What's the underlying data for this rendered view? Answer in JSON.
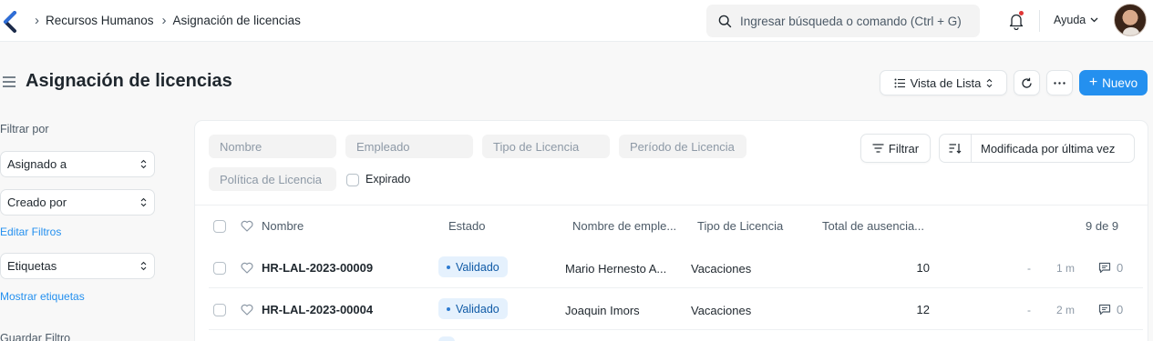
{
  "navbar": {
    "breadcrumbs": [
      "Recursos Humanos",
      "Asignación de licencias"
    ],
    "search_placeholder": "Ingresar búsqueda o comando (Ctrl + G)",
    "help_label": "Ayuda"
  },
  "page": {
    "title": "Asignación de licencias",
    "view_label": "Vista de Lista",
    "new_label": "Nuevo"
  },
  "sidebar": {
    "filter_by_label": "Filtrar por",
    "assigned_to": "Asignado a",
    "created_by": "Creado por",
    "edit_filters": "Editar Filtros",
    "tags": "Etiquetas",
    "show_tags": "Mostrar etiquetas",
    "save_filter": "Guardar Filtro"
  },
  "filters": {
    "name_placeholder": "Nombre",
    "employee_placeholder": "Empleado",
    "leave_type_placeholder": "Tipo de Licencia",
    "period_placeholder": "Período de Licencia",
    "policy_placeholder": "Política de Licencia",
    "expired_label": "Expirado",
    "filter_button": "Filtrar",
    "sort_label": "Modificada por última vez"
  },
  "table": {
    "columns": [
      "Nombre",
      "Estado",
      "Nombre de emple...",
      "Tipo de Licencia",
      "Total de ausencia..."
    ],
    "count": "9 de 9",
    "rows": [
      {
        "name": "HR-LAL-2023-00009",
        "status": "Validado",
        "employee": "Mario Hernesto A...",
        "leave_type": "Vacaciones",
        "total": "10",
        "dash": "-",
        "time": "1 m",
        "comments": "0"
      },
      {
        "name": "HR-LAL-2023-00004",
        "status": "Validado",
        "employee": "Joaquin Imors",
        "leave_type": "Vacaciones",
        "total": "12",
        "dash": "-",
        "time": "2 m",
        "comments": "0"
      }
    ]
  },
  "colors": {
    "primary": "#2490ef",
    "badge_bg": "#e5f1fd",
    "badge_text": "#0f5aa6",
    "notification_dot": "#e03636"
  },
  "icons": [
    "app-logo-icon",
    "chevron-right-icon",
    "search-icon",
    "bell-icon",
    "chevron-down-icon",
    "hamburger-icon",
    "list-icon",
    "sort-updown-icon",
    "reload-icon",
    "more-icon",
    "plus-icon",
    "filter-icon",
    "sort-icon",
    "heart-icon",
    "comment-icon"
  ]
}
